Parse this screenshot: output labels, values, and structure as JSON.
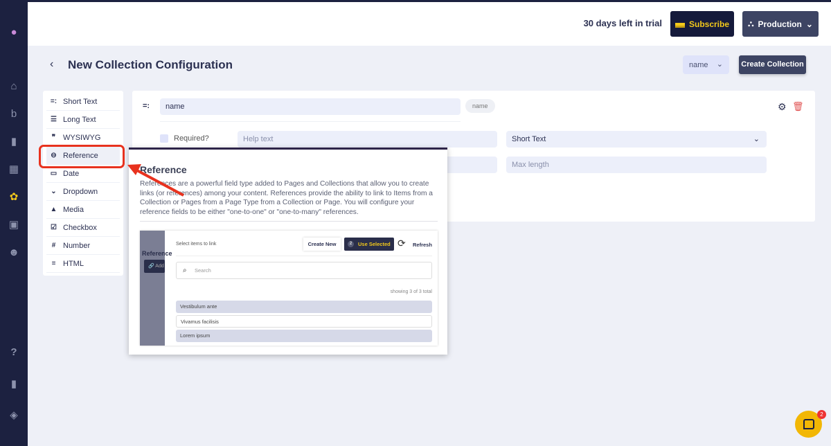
{
  "sidebar": {
    "icons": [
      "logo-icon",
      "home-icon",
      "blog-icon",
      "page-icon",
      "layout-icon",
      "collections-icon",
      "media-icon",
      "users-icon",
      "help-icon",
      "docs-icon",
      "layers-icon"
    ]
  },
  "header": {
    "trial_text": "30 days left in trial",
    "subscribe_label": "Subscribe",
    "environment_label": "Production"
  },
  "page": {
    "back": "‹",
    "title": "New Collection Configuration",
    "display_field": "name",
    "create_label": "Create Collection"
  },
  "field_types": [
    {
      "label": "Short Text",
      "icon": "short-text-icon",
      "glyph": "=:"
    },
    {
      "label": "Long Text",
      "icon": "long-text-icon",
      "glyph": "☰"
    },
    {
      "label": "WYSIWYG",
      "icon": "quote-icon",
      "glyph": "❞"
    },
    {
      "label": "Reference",
      "icon": "link-icon",
      "glyph": "⊖"
    },
    {
      "label": "Date",
      "icon": "calendar-icon",
      "glyph": "▭"
    },
    {
      "label": "Dropdown",
      "icon": "chevron-down-icon",
      "glyph": "⌄"
    },
    {
      "label": "Media",
      "icon": "image-icon",
      "glyph": "▲"
    },
    {
      "label": "Checkbox",
      "icon": "checkbox-icon",
      "glyph": "☑"
    },
    {
      "label": "Number",
      "icon": "hash-icon",
      "glyph": "#"
    },
    {
      "label": "HTML",
      "icon": "list-icon",
      "glyph": "≡"
    }
  ],
  "selected_type": "Reference",
  "field": {
    "name": "name",
    "key_badge": "name",
    "required_label": "Required?",
    "help_placeholder": "Help text",
    "type_value": "Short Text",
    "max_length_placeholder": "Max length"
  },
  "popover": {
    "title": "Reference",
    "text": "References are a powerful field type added to Pages and Collections that allow you to create links (or references) among your content. References provide the ability to link to Items from a Collection or Pages from a Page Type from a Collection or Page. You will configure your reference fields to be either \"one-to-one\" or \"one-to-many\" references.",
    "demo": {
      "side_label": "Reference",
      "side_button": "Add",
      "label": "Select items to link",
      "create_new": "Create New",
      "use_selected": "Use Selected",
      "selected_count": "2",
      "refresh": "Refresh",
      "search_placeholder": "Search",
      "count_text": "showing 3 of 3 total",
      "items": [
        {
          "label": "Vestibulum ante",
          "selected": true
        },
        {
          "label": "Vivamus facilisis",
          "selected": false
        },
        {
          "label": "Lorem ipsum",
          "selected": true
        }
      ]
    }
  },
  "chat": {
    "badge": "2"
  },
  "colors": {
    "sidebar": "#1c2140",
    "accent_yellow": "#f2c81b",
    "highlight_red": "#e8321e",
    "delete_red": "#e05252"
  }
}
